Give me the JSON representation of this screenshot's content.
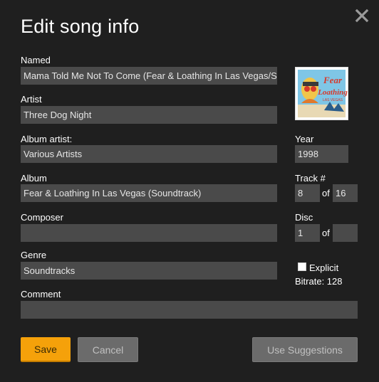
{
  "dialog": {
    "title": "Edit song info",
    "close_icon": "close-icon"
  },
  "fields": {
    "named": {
      "label": "Named",
      "value": "Mama Told Me Not To Come (Fear & Loathing In Las Vegas/Soundtrack Version)"
    },
    "artist": {
      "label": "Artist",
      "value": "Three Dog Night"
    },
    "album_artist": {
      "label": "Album artist:",
      "value": "Various Artists"
    },
    "album": {
      "label": "Album",
      "value": "Fear & Loathing In Las Vegas (Soundtrack)"
    },
    "composer": {
      "label": "Composer",
      "value": ""
    },
    "genre": {
      "label": "Genre",
      "value": "Soundtracks"
    },
    "comment": {
      "label": "Comment",
      "value": ""
    },
    "year": {
      "label": "Year",
      "value": "1998"
    },
    "track": {
      "label": "Track #",
      "value": "8",
      "of_label": "of",
      "total": "16"
    },
    "disc": {
      "label": "Disc",
      "value": "1",
      "of_label": "of",
      "total": ""
    },
    "explicit": {
      "label": "Explicit",
      "checked": false
    },
    "bitrate": "Bitrate: 128"
  },
  "album_art": {
    "icon": "album-art-image",
    "colors": {
      "sky": "#7fc6e6",
      "title": "#d63a2c",
      "figure": "#e9c44a"
    }
  },
  "buttons": {
    "save_label": "Save",
    "cancel_label": "Cancel",
    "suggestions_label": "Use Suggestions"
  },
  "colors": {
    "background": "#1f1f1f",
    "field": "#4a4a4a",
    "accent": "#f5a10a",
    "disabled_button": "#6b6b6b"
  }
}
